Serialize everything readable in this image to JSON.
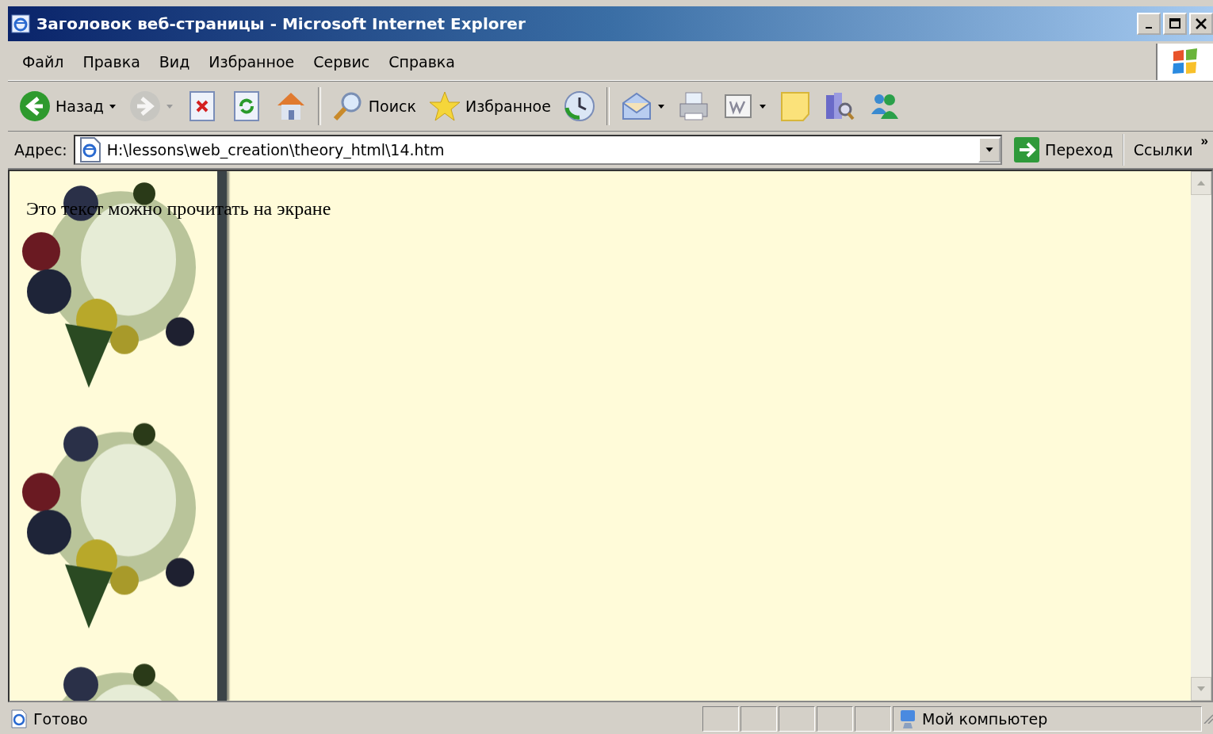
{
  "window": {
    "title": "Заголовок веб-страницы - Microsoft Internet Explorer"
  },
  "menu": [
    {
      "label": "Файл"
    },
    {
      "label": "Правка"
    },
    {
      "label": "Вид"
    },
    {
      "label": "Избранное"
    },
    {
      "label": "Сервис"
    },
    {
      "label": "Справка"
    }
  ],
  "toolbar": [
    {
      "kind": "back",
      "label": "Назад",
      "dropdown": true,
      "disabled": false
    },
    {
      "kind": "forward",
      "dropdown": true,
      "disabled": true
    },
    {
      "kind": "stop",
      "dropdown": false,
      "disabled": false
    },
    {
      "kind": "refresh",
      "dropdown": false,
      "disabled": false
    },
    {
      "kind": "home",
      "dropdown": false,
      "disabled": false
    },
    {
      "kind": "separator"
    },
    {
      "kind": "search",
      "label": "Поиск",
      "dropdown": false,
      "disabled": false
    },
    {
      "kind": "favorites",
      "label": "Избранное",
      "dropdown": false,
      "disabled": false
    },
    {
      "kind": "history",
      "dropdown": false,
      "disabled": false
    },
    {
      "kind": "separator"
    },
    {
      "kind": "mail",
      "dropdown": true,
      "disabled": false
    },
    {
      "kind": "print",
      "dropdown": false,
      "disabled": false
    },
    {
      "kind": "edit",
      "dropdown": true,
      "disabled": false
    },
    {
      "kind": "note",
      "dropdown": false,
      "disabled": false
    },
    {
      "kind": "research",
      "dropdown": false,
      "disabled": false
    },
    {
      "kind": "messenger",
      "dropdown": false,
      "disabled": false
    }
  ],
  "address_bar": {
    "label": "Адрес:",
    "value": "H:\\lessons\\web_creation\\theory_html\\14.htm",
    "go": "Переход",
    "links": "Ссылки",
    "more": "»"
  },
  "page": {
    "text": "Это текст можно прочитать на экране"
  },
  "status_bar": {
    "text": "Готово",
    "zone": "Мой компьютер"
  }
}
